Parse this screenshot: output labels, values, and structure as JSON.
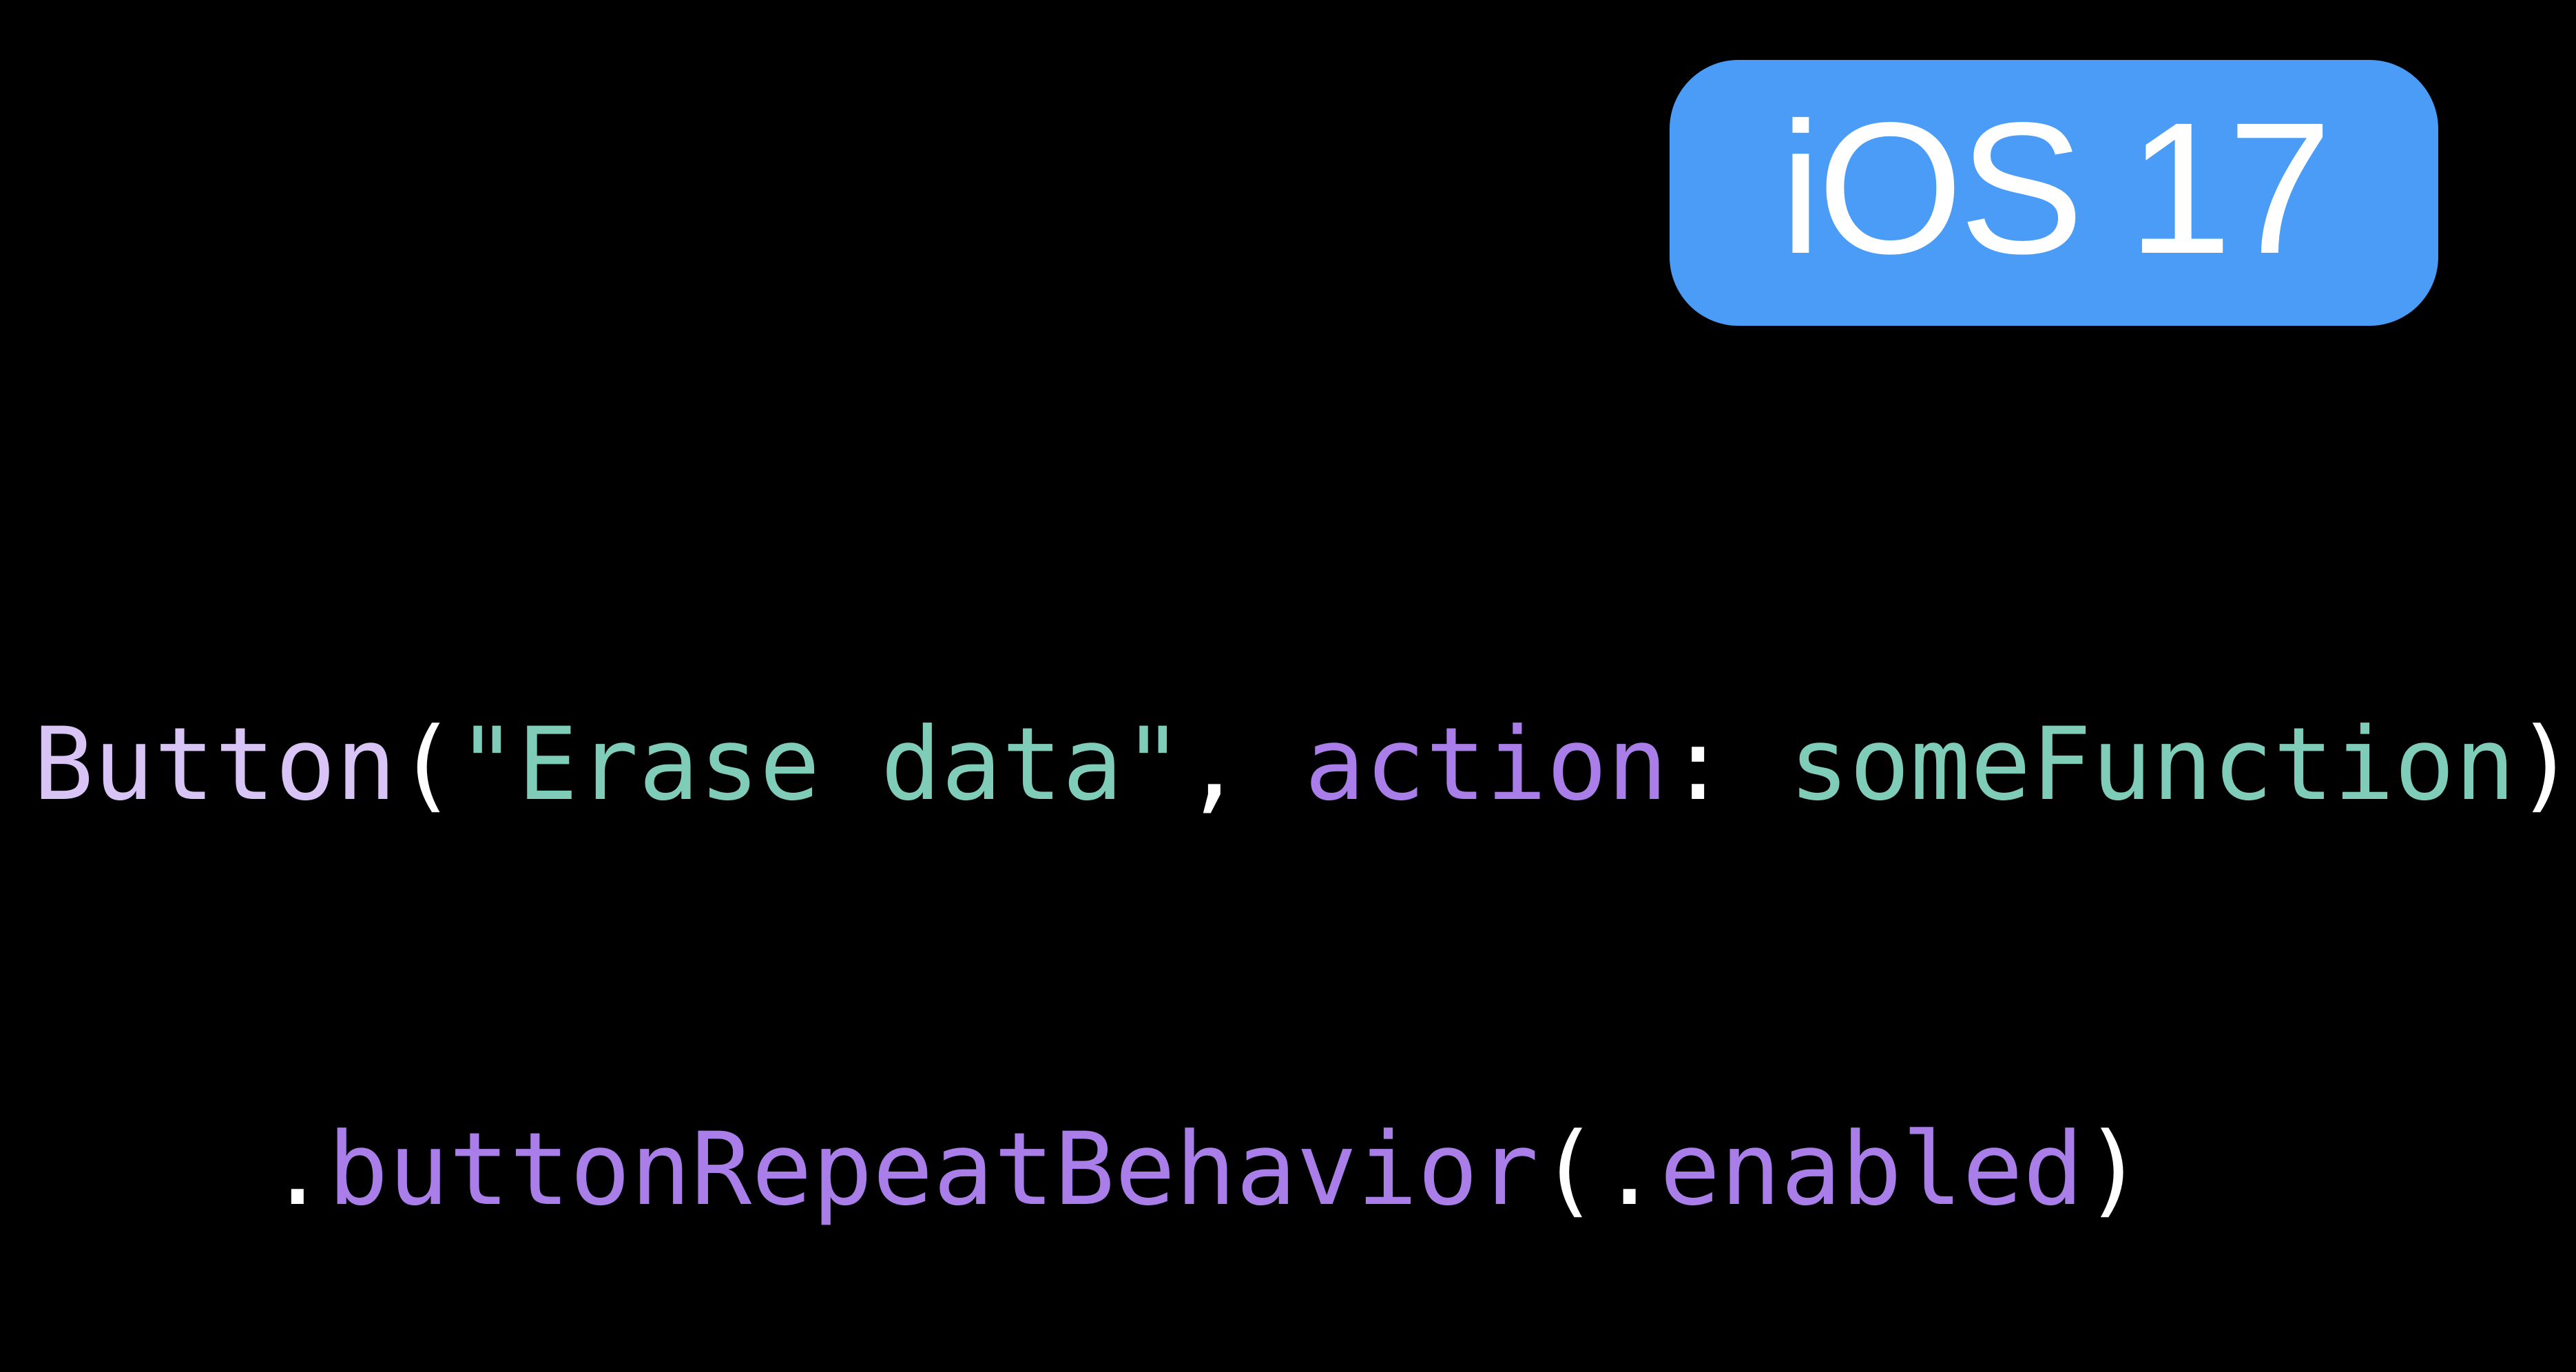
{
  "badge": {
    "text": "iOS 17"
  },
  "code": {
    "line1": {
      "type_name": "Button",
      "open_paren": "(",
      "string_literal": "\"Erase data\"",
      "comma": ",",
      "space": " ",
      "param_label": "action",
      "colon": ":",
      "space2": " ",
      "function_name": "someFunction",
      "close_paren": ")"
    },
    "line2": {
      "dot": ".",
      "modifier_name": "buttonRepeatBehavior",
      "open_paren": "(",
      "dot2": ".",
      "enum_case": "enabled",
      "close_paren": ")"
    }
  },
  "colors": {
    "background": "#000000",
    "badge": "#4a9cf6",
    "type_name": "#d9c5f5",
    "string_literal": "#7fcdb8",
    "keyword_purple": "#a97ee8",
    "function_name": "#7fcdb8",
    "punctuation": "#ffffff"
  }
}
